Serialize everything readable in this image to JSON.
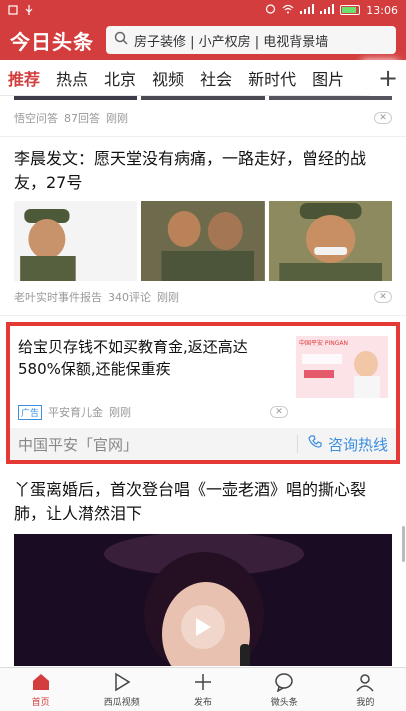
{
  "status": {
    "time": "13:06"
  },
  "header": {
    "logo": "今日头条",
    "search_text": "房子装修 | 小产权房 | 电视背景墙"
  },
  "tabs": [
    "推荐",
    "热点",
    "北京",
    "视频",
    "社会",
    "新时代",
    "图片"
  ],
  "feed": {
    "item0": {
      "source": "悟空问答",
      "answers": "87回答",
      "time": "刚刚"
    },
    "item1": {
      "title": "李晨发文：愿天堂没有病痛，一路走好，曾经的战友，27号",
      "source": "老叶实时事件报告",
      "comments": "340评论",
      "time": "刚刚"
    },
    "ad": {
      "title": "给宝贝存钱不如买教育金,返还高达580%保额,还能保重疾",
      "badge": "广告",
      "source": "平安育儿金",
      "time": "刚刚",
      "brand": "中国平安「官网」",
      "hotline": "咨询热线",
      "img_caption": "中国平安 PINGAN"
    },
    "item2": {
      "title": "丫蛋离婚后，首次登台唱《一壶老酒》唱的撕心裂肺，让人潸然泪下"
    }
  },
  "bottom_nav": [
    "首页",
    "西瓜视频",
    "发布",
    "微头条",
    "我的"
  ],
  "colors": {
    "brand_red": "#d43d3d",
    "link_blue": "#3b8ee0",
    "highlight_border": "#e53935"
  }
}
